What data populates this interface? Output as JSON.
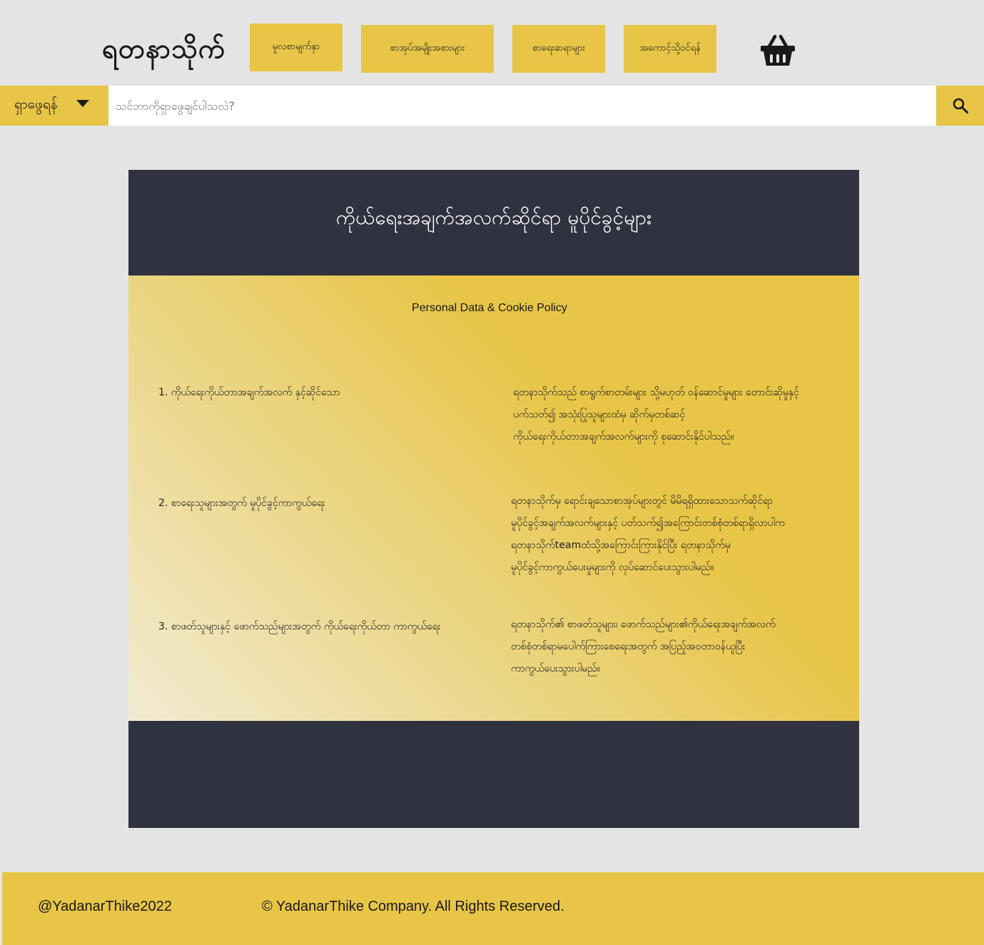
{
  "header": {
    "logo_text": "ရတနာသိုက်",
    "nav": [
      {
        "label": "မူလစာမျက်နှာ"
      },
      {
        "label": "စာအုပ်အမျိုးအစားများ"
      },
      {
        "label": "စာရေးဆရာများ"
      },
      {
        "label": "အကောင့်သို့ဝင်ရန်"
      }
    ],
    "cart_icon": "basket-icon"
  },
  "search": {
    "dropdown_label": "ရှာဖွေရန်",
    "placeholder": "သင်ဘာကိုရှာဖွေချင်ပါသလဲ?",
    "value": "",
    "button_icon": "search-icon"
  },
  "main": {
    "title": "ကိုယ်ရေးအချက်အလက်ဆိုင်ရာ မူပိုင်ခွင့်များ",
    "subtitle": "Personal Data & Cookie Policy",
    "sections": [
      {
        "heading": "1. ကိုယ်ရေးကိုယ်တာအချက်အလက် နှင့်ဆိုင်သော",
        "lines": [
          "ရတနာသိုက်သည် စာရွက်စာတမ်းများ သို့မဟုတ် ဝန်ဆောင်မှုများ တောင်းဆိုမှုနှင့်",
          "ပက်သတ်၍ အသုံးပြုသူများထံမှ ဆိုက်မှတစ်ဆင့်",
          "ကိုယ်ရေးကိုယ်တာအချက်အလက်များကို စုဆောင်းနိုင်ပါသည်။"
        ]
      },
      {
        "heading": "2.  စာရေးသူများအတွက် မူပိုင်ခွင့်ကာကွယ်ရေး",
        "lines": [
          "ရတနာသိုက်မှ ရောင်းချသောစာအုပ်များတွင် မိမိရရှိထားသောသက်ဆိုင်ရာ",
          "မူပိုင်ခွင့်အချက်အလက်များနှင့် ပတ်သက်၍အကြောင်းတစ်စုံတစ်ရာရှိလာပါက",
          "ရတနာသိုက်teamထံသို့အကြောင်းကြားနိုင်ပြီး  ရတနာသိုက်မှ",
          "မူပိုင်ခွင့်ကာကွယ်ပေးမှုများကို  လုပ်ဆောင်ပေးသွားပါမည်။"
        ]
      },
      {
        "heading": "3.  စာဖတ်သူများနှင့် ဖောက်သည်များအတွက် ကိုယ်ရေးကိုယ်တာ ကာကွယ်ရေး",
        "lines": [
          "ရတနာသိုက်၏ စာဖတ်သူများ၊ ဖောက်သည်များ၏ကိုယ်ရေးအချက်အလက်",
          "တစ်စုံတစ်ရာမပေါက်ကြားစေရေးအတွက် အပြည့်အဝတာဝန်ယူပြီး",
          "ကာကွယ်ပေးသွားပါမည်။"
        ]
      }
    ]
  },
  "footer": {
    "handle": "@YadanarThike2022",
    "copyright": "© YadanarThike Company. All Rights Reserved."
  },
  "colors": {
    "accent": "#e8c547",
    "dark": "#30333f",
    "background": "#e4e4e4"
  }
}
